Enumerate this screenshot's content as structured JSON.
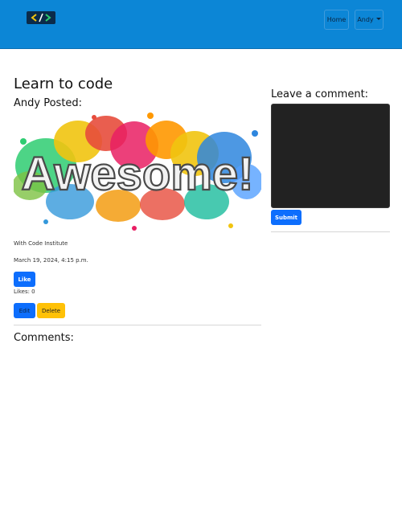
{
  "navbar": {
    "logo_text": "</>",
    "home_label": "Home",
    "user_label": "Andy",
    "colors": {
      "background": "#0c86d6",
      "logo_bg": "#0b2b4a"
    }
  },
  "post": {
    "title": "Learn to code",
    "author_line": "Andy Posted:",
    "image": {
      "caption_word": "Awesome!",
      "icon": "awesome-paint-splash-image"
    },
    "excerpt": "With Code Institute",
    "date": "March 19, 2024, 4:15 p.m.",
    "like_label": "Like",
    "likes_text": "Likes: 0",
    "edit_label": "Edit",
    "delete_label": "Delete",
    "comments_heading": "Comments:"
  },
  "comment_form": {
    "heading": "Leave a comment:",
    "textarea_value": "",
    "submit_label": "Submit"
  },
  "colors": {
    "primary": "#0d6efd",
    "warning": "#ffc107",
    "textarea_bg": "#222222"
  }
}
